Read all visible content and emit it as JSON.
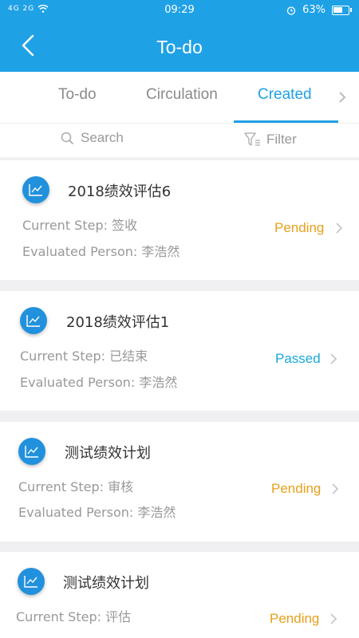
{
  "status_bar": {
    "signal_text": "4G 2G",
    "time": "09:29",
    "battery": "63%",
    "battery_level": 0.63
  },
  "header": {
    "title": "To-do",
    "back_icon": "chevron-left-icon"
  },
  "tabs": [
    {
      "label": "To-do",
      "active": false
    },
    {
      "label": "Circulation",
      "active": false
    },
    {
      "label": "Created",
      "active": true
    }
  ],
  "toolbar": {
    "search_label": "Search",
    "filter_label": "Filter"
  },
  "colors": {
    "accent": "#1fa1e6",
    "pending": "#e8a01a",
    "passed": "#1aa8d8"
  },
  "labels": {
    "current_step": "Current Step:",
    "evaluated_person": "Evaluated Person:"
  },
  "items": [
    {
      "title": "2018绩效评估6",
      "step": "签收",
      "person": "李浩然",
      "status": "Pending",
      "status_type": "pending"
    },
    {
      "title": "2018绩效评估1",
      "step": "已结束",
      "person": "李浩然",
      "status": "Passed",
      "status_type": "passed"
    },
    {
      "title": "测试绩效计划",
      "step": "审核",
      "person": "李浩然",
      "status": "Pending",
      "status_type": "pending"
    },
    {
      "title": "测试绩效计划",
      "step": "评估",
      "person": "",
      "status": "Pending",
      "status_type": "pending"
    }
  ]
}
